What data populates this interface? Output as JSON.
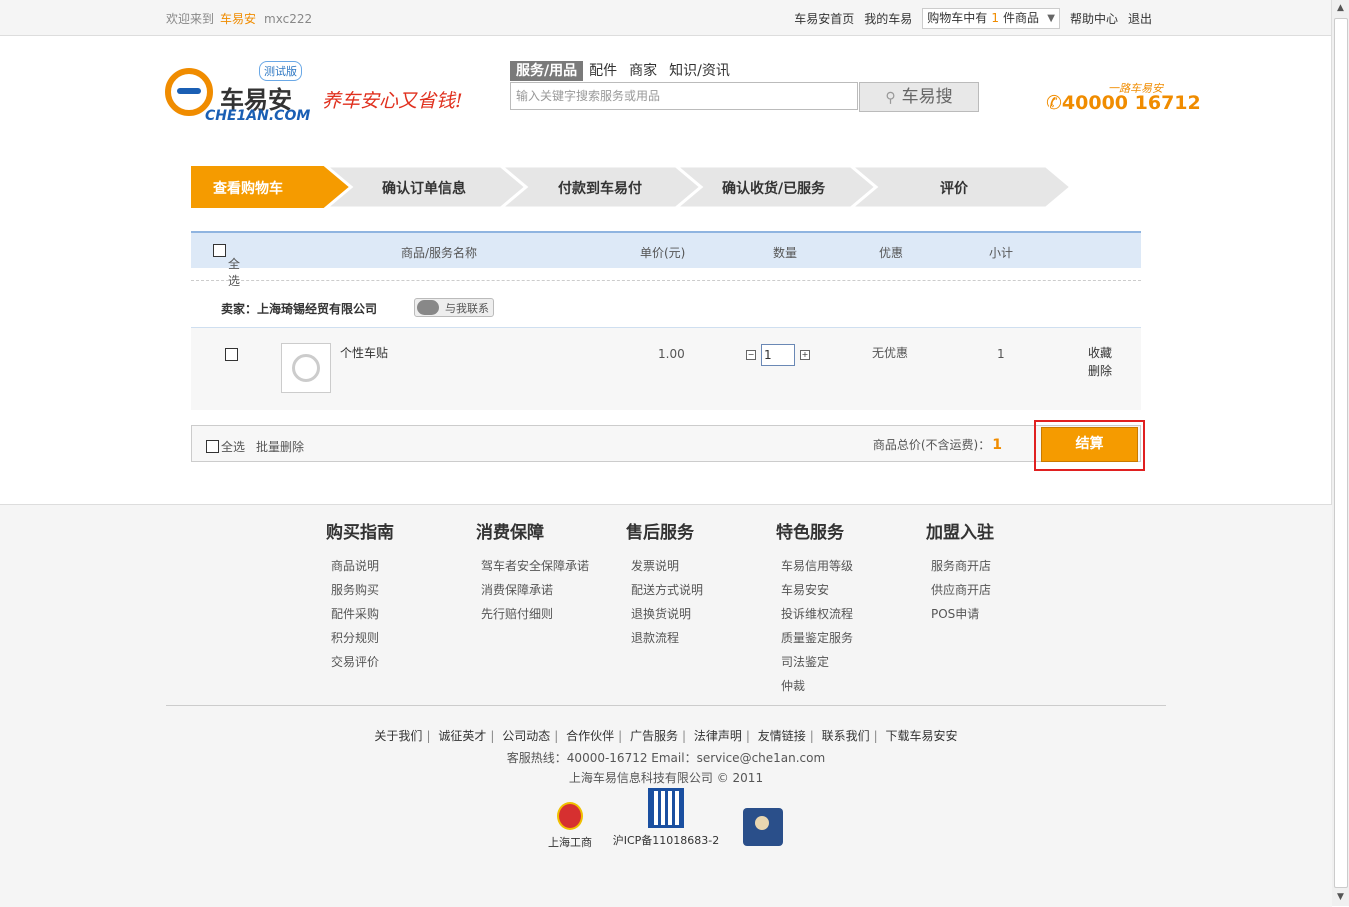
{
  "topbar": {
    "welcome": "欢迎来到",
    "brand": "车易安",
    "user": "mxc222",
    "home": "车易安首页",
    "mine": "我的车易",
    "cart_prefix": "购物车中有",
    "cart_count": "1",
    "cart_suffix": "件商品",
    "help": "帮助中心",
    "logout": "退出"
  },
  "header": {
    "logo_cn": "车易安",
    "logo_en": "CHE1AN.COM",
    "badge": "测试版",
    "slogan": "养车安心又省钱!",
    "hotline_small": "一路车易安",
    "hotline": "40000 16712"
  },
  "search": {
    "tabs": [
      "服务/用品",
      "配件",
      "商家",
      "知识/资讯"
    ],
    "placeholder": "输入关键字搜索服务或用品",
    "button": "车易搜"
  },
  "steps": [
    "查看购物车",
    "确认订单信息",
    "付款到车易付",
    "确认收货/已服务",
    "评价"
  ],
  "table": {
    "select_all": "全选",
    "col_name": "商品/服务名称",
    "col_price": "单价(元)",
    "col_qty": "数量",
    "col_discount": "优惠",
    "col_subtotal": "小计"
  },
  "seller": {
    "label": "卖家：上海琦锡经贸有限公司",
    "contact": "与我联系"
  },
  "item": {
    "name": "个性车贴",
    "price": "1.00",
    "qty": "1",
    "discount": "无优惠",
    "subtotal": "1",
    "fav": "收藏",
    "delete": "删除"
  },
  "summary": {
    "select_all": "全选",
    "batch_delete": "批量删除",
    "total_label": "商品总价(不含运费)：",
    "total_value": "1",
    "checkout": "结算"
  },
  "footer": {
    "columns": [
      {
        "title": "购买指南",
        "links": [
          "商品说明",
          "服务购买",
          "配件采购",
          "积分规则",
          "交易评价"
        ]
      },
      {
        "title": "消费保障",
        "links": [
          "驾车者安全保障承诺",
          "消费保障承诺",
          "先行赔付细则"
        ]
      },
      {
        "title": "售后服务",
        "links": [
          "发票说明",
          "配送方式说明",
          "退换货说明",
          "退款流程"
        ]
      },
      {
        "title": "特色服务",
        "links": [
          "车易信用等级",
          "车易安安",
          "投诉维权流程",
          "质量鉴定服务",
          "司法鉴定",
          "仲裁"
        ]
      },
      {
        "title": "加盟入驻",
        "links": [
          "服务商开店",
          "供应商开店",
          "POS申请"
        ]
      }
    ],
    "bottom_links": [
      "关于我们",
      "诚征英才",
      "公司动态",
      "合作伙伴",
      "广告服务",
      "法律声明",
      "友情链接",
      "联系我们",
      "下载车易安安"
    ],
    "hotline_line": "客服热线：40000-16712 Email：service@che1an.com",
    "copyright": "上海车易信息科技有限公司 © 2011",
    "icon1_label": "上海工商",
    "icon2_label": "沪ICP备11018683-2"
  },
  "colors": {
    "accent": "#f59b00",
    "step_inactive": "#e6e6e6",
    "highlight_border": "#e02020"
  }
}
